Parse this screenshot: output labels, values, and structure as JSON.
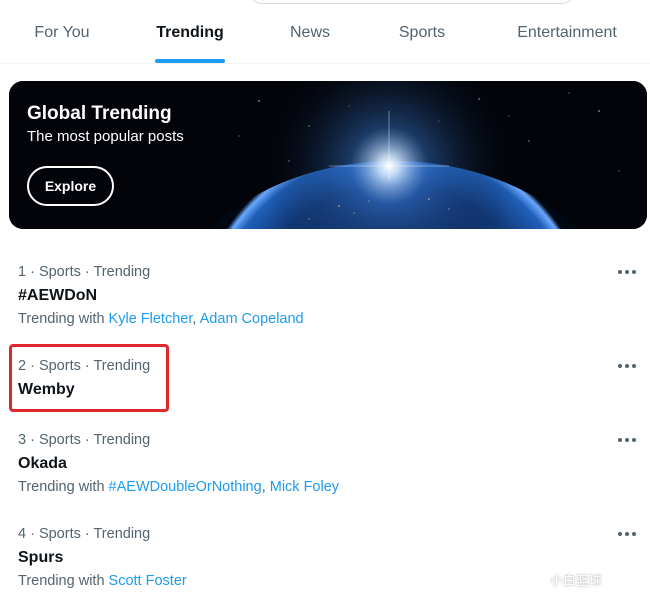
{
  "tabs": [
    {
      "label": "For You",
      "active": false
    },
    {
      "label": "Trending",
      "active": true
    },
    {
      "label": "News",
      "active": false
    },
    {
      "label": "Sports",
      "active": false
    },
    {
      "label": "Entertainment",
      "active": false
    }
  ],
  "banner": {
    "title": "Global Trending",
    "subtitle": "The most popular posts",
    "button_label": "Explore"
  },
  "trends": [
    {
      "meta": "1 · Sports · Trending",
      "name": "#AEWDoN",
      "with_prefix": "Trending with",
      "with_links": [
        "Kyle Fletcher",
        "Adam Copeland"
      ]
    },
    {
      "meta": "2 · Sports · Trending",
      "name": "Wemby",
      "with_prefix": "",
      "with_links": []
    },
    {
      "meta": "3 · Sports · Trending",
      "name": "Okada",
      "with_prefix": "Trending with",
      "with_links": [
        "#AEWDoubleOrNothing",
        "Mick Foley"
      ]
    },
    {
      "meta": "4 · Sports · Trending",
      "name": "Spurs",
      "with_prefix": "Trending with",
      "with_links": [
        "Scott Foster"
      ]
    }
  ],
  "watermark": {
    "text": "小白篮球"
  },
  "colors": {
    "accent": "#1d9bf0",
    "highlight": "#e0282c",
    "text_primary": "#0f1419",
    "text_secondary": "#536471"
  }
}
